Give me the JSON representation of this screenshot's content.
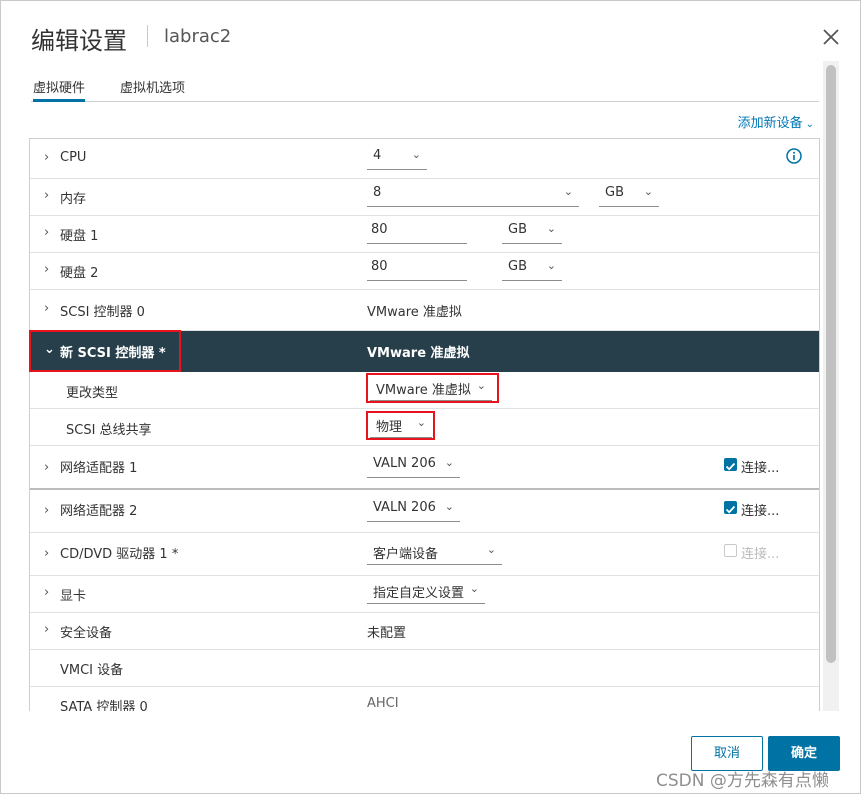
{
  "dialog": {
    "title": "编辑设置",
    "subtitle": "labrac2"
  },
  "tabs": [
    "虚拟硬件",
    "虚拟机选项"
  ],
  "add_device": "添加新设备",
  "rows": {
    "cpu": {
      "label": "CPU",
      "value": "4"
    },
    "memory": {
      "label": "内存",
      "value": "8",
      "unit": "GB"
    },
    "disk1": {
      "label": "硬盘 1",
      "value": "80",
      "unit": "GB"
    },
    "disk2": {
      "label": "硬盘 2",
      "value": "80",
      "unit": "GB"
    },
    "scsi0": {
      "label": "SCSI 控制器 0",
      "value": "VMware 准虚拟"
    },
    "new_scsi": {
      "label": "新 SCSI 控制器 *",
      "value": "VMware 准虚拟"
    },
    "change_type": {
      "label": "更改类型",
      "value": "VMware 准虚拟"
    },
    "bus_sharing": {
      "label": "SCSI 总线共享",
      "value": "物理"
    },
    "net1": {
      "label": "网络适配器 1",
      "value": "VALN 206",
      "connect": "连接..."
    },
    "net2": {
      "label": "网络适配器 2",
      "value": "VALN 206",
      "connect": "连接..."
    },
    "cdrom": {
      "label": "CD/DVD 驱动器 1 *",
      "value": "客户端设备",
      "connect": "连接..."
    },
    "video": {
      "label": "显卡",
      "value": "指定自定义设置"
    },
    "security": {
      "label": "安全设备",
      "value": "未配置"
    },
    "vmci": {
      "label": "VMCI 设备"
    },
    "sata0": {
      "label": "SATA 控制器 0",
      "value": "AHCI"
    }
  },
  "buttons": {
    "cancel": "取消",
    "ok": "确定"
  },
  "watermark": "CSDN @方先森有点懒",
  "colors": {
    "accent": "#0072a3",
    "selected_row": "#263f4b",
    "highlight": "#e8141d"
  }
}
